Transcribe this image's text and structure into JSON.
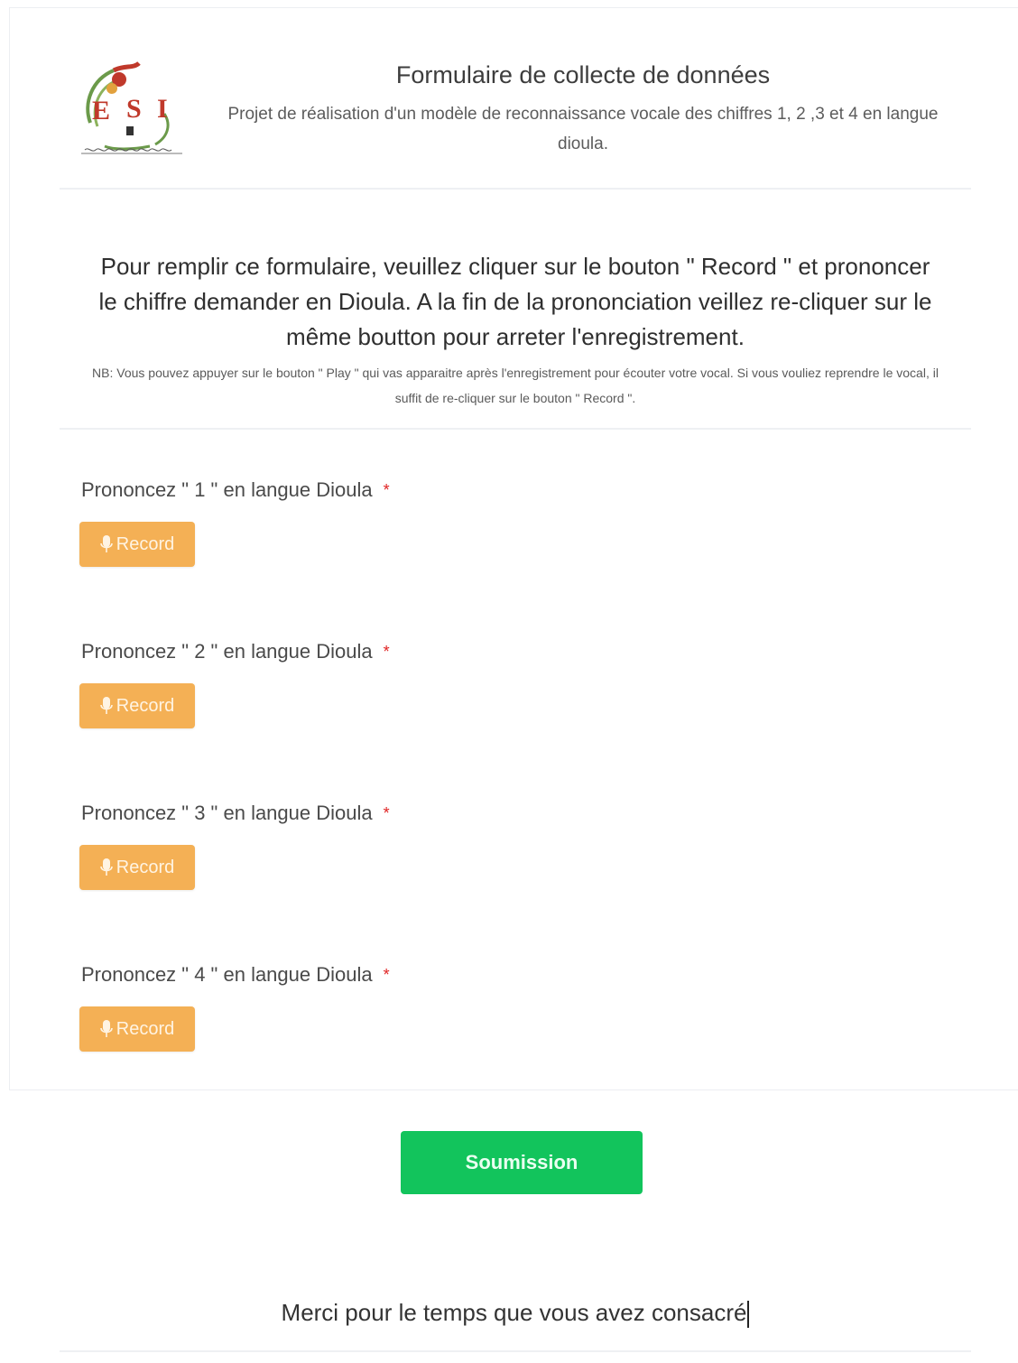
{
  "header": {
    "logo_text": "ESI",
    "title": "Formulaire de collecte de données",
    "subtitle": "Projet de réalisation d'un modèle de reconnaissance vocale des chiffres 1, 2 ,3 et 4 en langue dioula."
  },
  "instructions": {
    "main": "Pour remplir ce formulaire, veuillez cliquer sur le bouton \" Record \" et prononcer le chiffre demander en Dioula. A la fin de la prononciation veillez re-cliquer sur le même boutton pour arreter l'enregistrement.",
    "note": "NB: Vous pouvez appuyer sur le bouton \" Play \" qui vas apparaitre après l'enregistrement pour écouter votre vocal. Si vous vouliez reprendre le vocal, il suffit de re-cliquer sur le bouton \" Record \"."
  },
  "questions": [
    {
      "label": "Prononcez \" 1 \" en langue Dioula",
      "required_mark": "*",
      "button_label": "Record"
    },
    {
      "label": "Prononcez \" 2 \" en langue Dioula",
      "required_mark": "*",
      "button_label": "Record"
    },
    {
      "label": "Prononcez \" 3 \" en langue Dioula",
      "required_mark": "*",
      "button_label": "Record"
    },
    {
      "label": "Prononcez \" 4 \" en langue Dioula",
      "required_mark": "*",
      "button_label": "Record"
    }
  ],
  "submit": {
    "label": "Soumission"
  },
  "footer": {
    "thanks": "Merci pour le temps que vous avez consacré"
  },
  "colors": {
    "record_button": "#f4b055",
    "submit_button": "#12c45c",
    "required_star": "#e02424"
  },
  "icons": {
    "record": "microphone-icon",
    "logo": "esi-logo"
  }
}
